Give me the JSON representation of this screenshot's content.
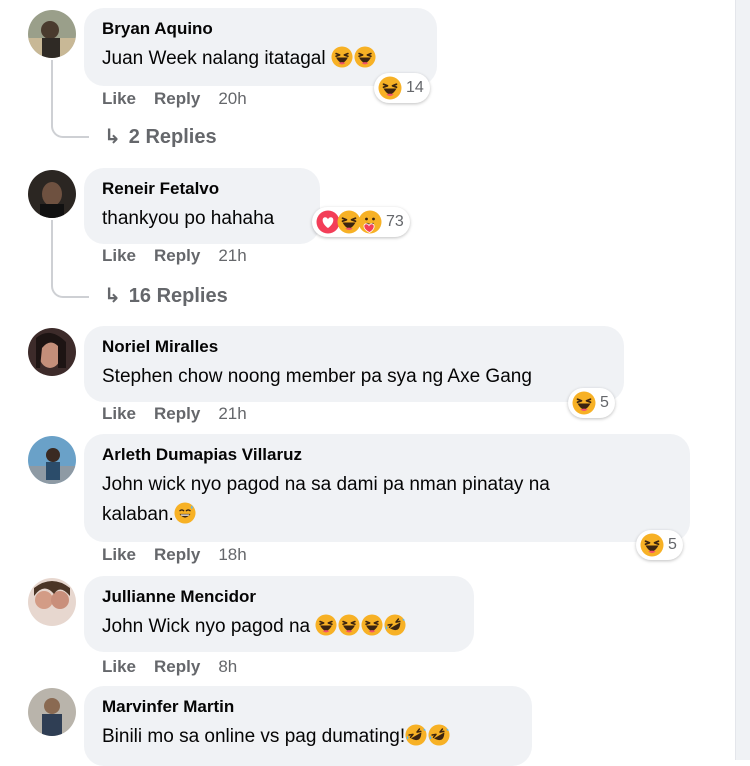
{
  "colors": {
    "bubble": "#f0f2f5",
    "meta": "#65676b",
    "text": "#050505",
    "haha": "#f7b125",
    "love": "#f33e58"
  },
  "comments": [
    {
      "name": "Bryan Aquino",
      "text": "Juan Week nalang itatagal",
      "inline_emojis": [
        "haha-emoji",
        "haha-emoji"
      ],
      "like": "Like",
      "reply": "Reply",
      "time": "20h",
      "reaction_icons": [
        "haha-icon"
      ],
      "reaction_count": "14",
      "replies_label": "2 Replies"
    },
    {
      "name": "Reneir Fetalvo",
      "text": "thankyou po hahaha",
      "like": "Like",
      "reply": "Reply",
      "time": "21h",
      "reaction_icons": [
        "love-icon",
        "haha-icon",
        "care-icon"
      ],
      "reaction_count": "73",
      "replies_label": "16 Replies"
    },
    {
      "name": "Noriel Miralles",
      "text": "Stephen chow noong member pa sya ng Axe Gang",
      "like": "Like",
      "reply": "Reply",
      "time": "21h",
      "reaction_icons": [
        "haha-icon"
      ],
      "reaction_count": "5"
    },
    {
      "name": "Arleth Dumapias Villaruz",
      "text_line1": "John wick nyo pagod na sa dami pa nman pinatay na",
      "text_line2": "kalaban.",
      "inline_emojis": [
        "grin-sweat-emoji"
      ],
      "like": "Like",
      "reply": "Reply",
      "time": "18h",
      "reaction_icons": [
        "haha-icon"
      ],
      "reaction_count": "5"
    },
    {
      "name": "Jullianne Mencidor",
      "text": "John Wick nyo pagod na",
      "inline_emojis": [
        "haha-emoji",
        "haha-emoji",
        "haha-emoji",
        "rofl-emoji"
      ],
      "like": "Like",
      "reply": "Reply",
      "time": "8h"
    },
    {
      "name": "Marvinfer Martin",
      "text": "Binili mo sa online vs pag dumating!",
      "inline_emojis": [
        "rofl-emoji",
        "rofl-emoji"
      ]
    }
  ]
}
